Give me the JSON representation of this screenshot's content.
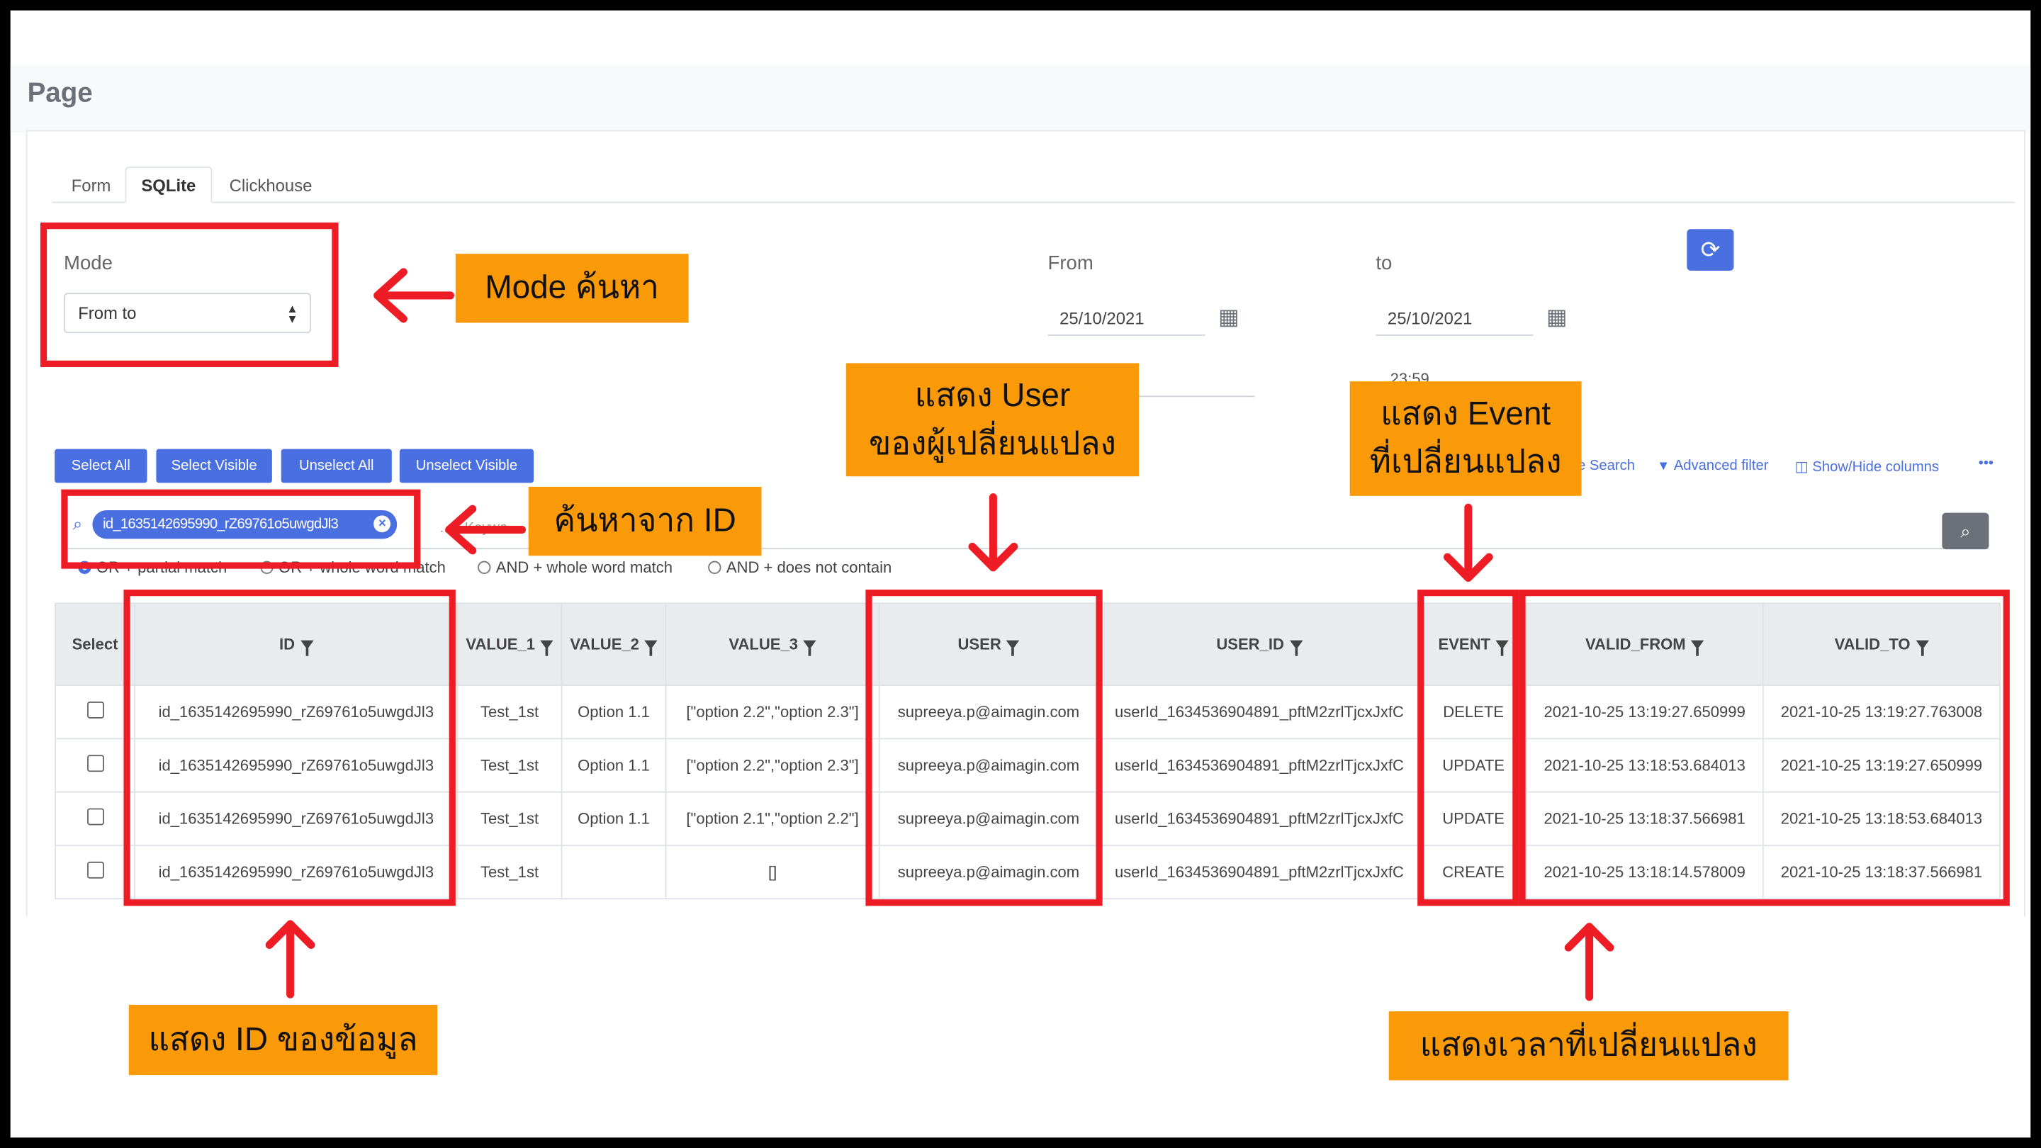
{
  "page": {
    "title": "Page"
  },
  "tabs": [
    {
      "label": "Form",
      "active": false
    },
    {
      "label": "SQLite",
      "active": true
    },
    {
      "label": "Clickhouse",
      "active": false
    }
  ],
  "mode": {
    "label": "Mode",
    "selected": "From to"
  },
  "from": {
    "label": "From",
    "date": "25/10/2021"
  },
  "to": {
    "label": "to",
    "date": "25/10/2021",
    "time": "23:59"
  },
  "buttons": {
    "select_all": "Select All",
    "select_visible": "Select Visible",
    "unselect_all": "Unselect All",
    "unselect_visible": "Unselect Visible"
  },
  "toolbar": {
    "search_fragment": "e Search",
    "advanced_filter": "Advanced filter",
    "show_hide": "Show/Hide columns",
    "more": "•••"
  },
  "search": {
    "chip": "id_1635142695990_rZ69761o5uwgdJl3",
    "placeholder_fragment": "..rd Keywo"
  },
  "match_options": [
    {
      "label": "OR + partial match",
      "checked": true
    },
    {
      "label": "OR + whole word match",
      "checked": false
    },
    {
      "label": "AND + whole word match",
      "checked": false
    },
    {
      "label": "AND + does not contain",
      "checked": false
    }
  ],
  "table": {
    "headers": [
      "Select",
      "ID",
      "VALUE_1",
      "VALUE_2",
      "VALUE_3",
      "USER",
      "USER_ID",
      "EVENT",
      "VALID_FROM",
      "VALID_TO"
    ],
    "rows": [
      [
        "id_1635142695990_rZ69761o5uwgdJl3",
        "Test_1st",
        "Option 1.1",
        "[\"option 2.2\",\"option 2.3\"]",
        "supreeya.p@aimagin.com",
        "userId_1634536904891_pftM2zrlTjcxJxfC",
        "DELETE",
        "2021-10-25 13:19:27.650999",
        "2021-10-25 13:19:27.763008"
      ],
      [
        "id_1635142695990_rZ69761o5uwgdJl3",
        "Test_1st",
        "Option 1.1",
        "[\"option 2.2\",\"option 2.3\"]",
        "supreeya.p@aimagin.com",
        "userId_1634536904891_pftM2zrlTjcxJxfC",
        "UPDATE",
        "2021-10-25 13:18:53.684013",
        "2021-10-25 13:19:27.650999"
      ],
      [
        "id_1635142695990_rZ69761o5uwgdJl3",
        "Test_1st",
        "Option 1.1",
        "[\"option 2.1\",\"option 2.2\"]",
        "supreeya.p@aimagin.com",
        "userId_1634536904891_pftM2zrlTjcxJxfC",
        "UPDATE",
        "2021-10-25 13:18:37.566981",
        "2021-10-25 13:18:53.684013"
      ],
      [
        "id_1635142695990_rZ69761o5uwgdJl3",
        "Test_1st",
        "",
        "[]",
        "supreeya.p@aimagin.com",
        "userId_1634536904891_pftM2zrlTjcxJxfC",
        "CREATE",
        "2021-10-25 13:18:14.578009",
        "2021-10-25 13:18:37.566981"
      ]
    ]
  },
  "callouts": {
    "mode": "Mode ค้นหา",
    "search_id": "ค้นหาจาก ID",
    "user_line1": "แสดง User",
    "user_line2": "ของผู้เปลี่ยนแปลง",
    "event_line1": "แสดง Event",
    "event_line2": "ที่เปลี่ยนแปลง",
    "id": "แสดง ID ของข้อมูล",
    "time": "แสดงเวลาที่เปลี่ยนแปลง"
  },
  "colors": {
    "accent": "#4a6fe0",
    "callout": "#fb9a09",
    "annotation_red": "#ee1c24"
  }
}
